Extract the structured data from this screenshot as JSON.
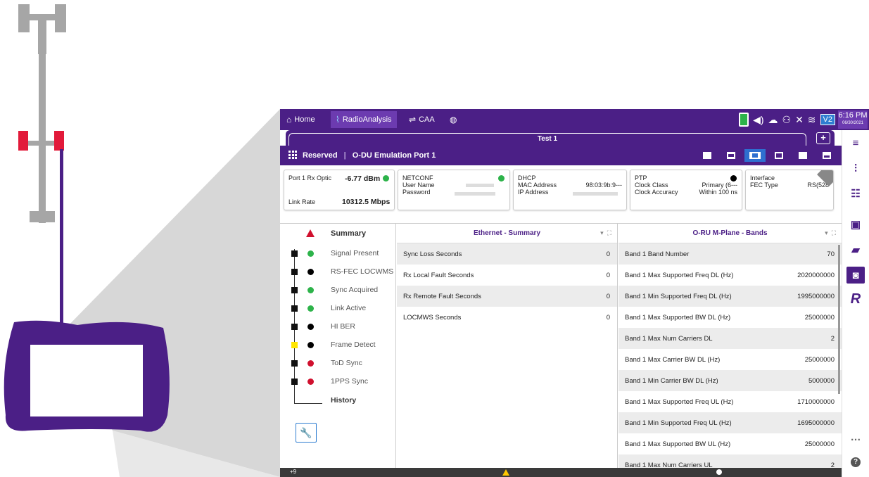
{
  "colors": {
    "brand": "#4b1f86",
    "accent": "#2e6fd0",
    "ok": "#2db34a",
    "alarm": "#d0102e",
    "warn": "#ffe600"
  },
  "tabs": {
    "home": "Home",
    "radio": "RadioAnalysis",
    "caa": "CAA"
  },
  "status": {
    "v2": "V2",
    "time": "6:16 PM",
    "date": "06/30/2021"
  },
  "test": {
    "title": "Test 1",
    "add": "+"
  },
  "sub": {
    "reserved": "Reserved",
    "port": "O-DU Emulation Port 1"
  },
  "cards": {
    "port": {
      "rx_label": "Port 1 Rx Optic",
      "rx_value": "-6.77 dBm",
      "link_label": "Link Rate",
      "link_value": "10312.5 Mbps"
    },
    "netconf": {
      "title": "NETCONF",
      "user": "User Name",
      "pass": "Password"
    },
    "dhcp": {
      "title": "DHCP",
      "mac_label": "MAC Address",
      "mac_value": "98:03:9b:9---",
      "ip_label": "IP Address"
    },
    "ptp": {
      "title": "PTP",
      "class_label": "Clock Class",
      "class_value": "Primary (6---",
      "acc_label": "Clock Accuracy",
      "acc_value": "Within 100 ns"
    },
    "iface": {
      "title": "Interface",
      "fec_label": "FEC Type",
      "fec_value": "RS(528"
    }
  },
  "summary": {
    "title": "Summary",
    "items": [
      {
        "label": "Signal Present",
        "status": "ok"
      },
      {
        "label": "RS-FEC LOCWMS",
        "status": "off"
      },
      {
        "label": "Sync Acquired",
        "status": "ok"
      },
      {
        "label": "Link Active",
        "status": "ok"
      },
      {
        "label": "HI BER",
        "status": "off"
      },
      {
        "label": "Frame Detect",
        "status": "off"
      },
      {
        "label": "ToD Sync",
        "status": "alarm"
      },
      {
        "label": "1PPS Sync",
        "status": "alarm"
      }
    ],
    "history": "History"
  },
  "ethernet": {
    "title": "Ethernet - Summary",
    "rows": [
      {
        "label": "Sync Loss Seconds",
        "value": "0"
      },
      {
        "label": "Rx Local Fault Seconds",
        "value": "0"
      },
      {
        "label": "Rx Remote Fault Seconds",
        "value": "0"
      },
      {
        "label": "LOCMWS Seconds",
        "value": "0"
      }
    ]
  },
  "oru": {
    "title": "O-RU M-Plane - Bands",
    "rows": [
      {
        "label": "Band 1 Band Number",
        "value": "70"
      },
      {
        "label": "Band 1 Max Supported Freq DL (Hz)",
        "value": "2020000000"
      },
      {
        "label": "Band 1 Min Supported Freq DL (Hz)",
        "value": "1995000000"
      },
      {
        "label": "Band 1 Max Supported BW DL (Hz)",
        "value": "25000000"
      },
      {
        "label": "Band 1 Max Num Carriers DL",
        "value": "2"
      },
      {
        "label": "Band 1 Max Carrier BW DL (Hz)",
        "value": "25000000"
      },
      {
        "label": "Band 1  Min Carrier BW DL (Hz)",
        "value": "5000000"
      },
      {
        "label": "Band 1 Max Supported Freq UL (Hz)",
        "value": "1710000000"
      },
      {
        "label": "Band 1 Min Supported Freq UL (Hz)",
        "value": "1695000000"
      },
      {
        "label": "Band 1 Max Supported BW UL (Hz)",
        "value": "25000000"
      },
      {
        "label": "Band 1 Max Num Carriers UL",
        "value": "2"
      }
    ]
  },
  "bottom": {
    "msgs": "+9"
  }
}
